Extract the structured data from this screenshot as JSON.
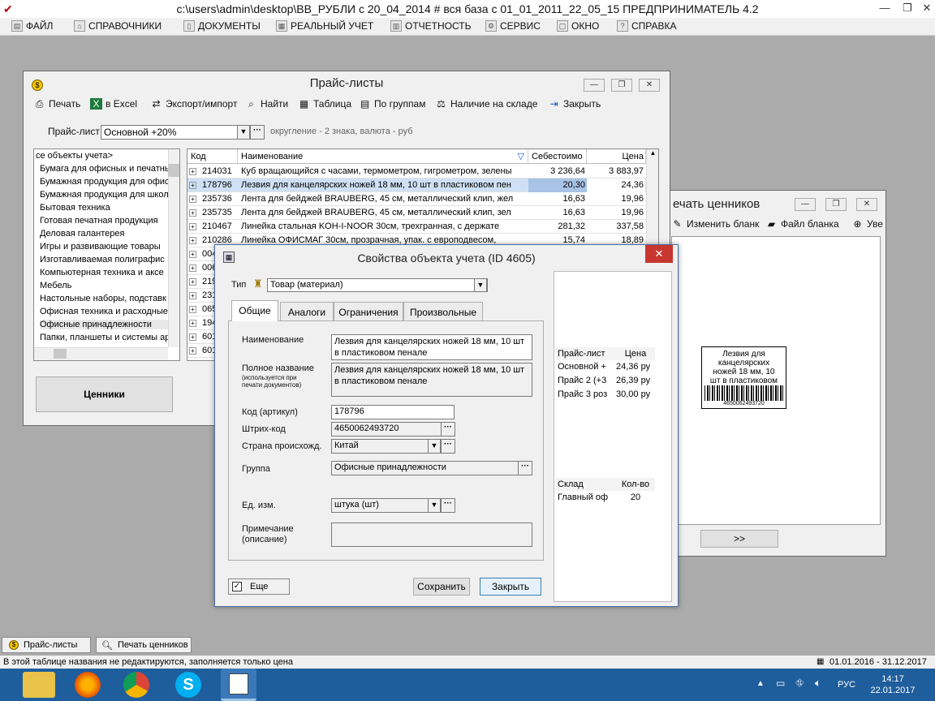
{
  "app": {
    "title": "c:\\users\\admin\\desktop\\BB_РУБЛИ с 20_04_2014 # вся база с 01_01_2011_22_05_15  ПРЕДПРИНИМАТЕЛЬ 4.2",
    "min": "—",
    "max": "❐",
    "close": "✕"
  },
  "menu": [
    "ФАЙЛ",
    "СПРАВОЧНИКИ",
    "ДОКУМЕНТЫ",
    "РЕАЛЬНЫЙ УЧЕТ",
    "ОТЧЕТНОСТЬ",
    "СЕРВИС",
    "ОКНО",
    "СПРАВКА"
  ],
  "pricelist_window": {
    "title": "Прайс-листы",
    "toolbar": {
      "print": "Печать",
      "excel": "в Excel",
      "export": "Экспорт/импорт",
      "find": "Найти",
      "table": "Таблица",
      "groups": "По группам",
      "stock": "Наличие на складе",
      "close": "Закрыть"
    },
    "pricelist_label": "Прайс-лист",
    "pricelist_value": "Основной +20%",
    "rounding_note": "округление - 2 знака, валюта - руб",
    "tree_items": [
      "се объекты учета>",
      "Бумага для офисных и печатнь",
      "Бумажная продукция для офис",
      "Бумажная продукция для школ",
      "Бытовая техника",
      "Готовая печатная продукция",
      "Деловая галантерея",
      "Игры и развивающие товары",
      "Изготавливаемая полиграфис",
      "Компьютерная техника и аксе",
      "Мебель",
      "Настольные наборы, подставк",
      "Офисная техника и расходные",
      "Офисные принадлежности",
      "Папки, планшеты и системы ар"
    ],
    "grid_headers": {
      "code": "Код",
      "name": "Наименование",
      "cost": "Себестоимо",
      "price": "Цена"
    },
    "rows": [
      {
        "code": "214031",
        "name": "Куб вращающийся с часами, термометром, гигрометром, зелены",
        "cost": "3 236,64",
        "price": "3 883,97"
      },
      {
        "code": "178796",
        "name": "Лезвия для канцелярских ножей 18 мм, 10 шт в пластиковом пен",
        "cost": "20,30",
        "price": "24,36"
      },
      {
        "code": "235736",
        "name": "Лента для бейджей BRAUBERG, 45 см, металлический клип, жел",
        "cost": "16,63",
        "price": "19,96"
      },
      {
        "code": "235735",
        "name": "Лента для бейджей BRAUBERG, 45 см, металлический клип, зел",
        "cost": "16,63",
        "price": "19,96"
      },
      {
        "code": "210467",
        "name": "Линейка стальная KOH-I-NOOR 30см, трехгранная, с держате",
        "cost": "281,32",
        "price": "337,58"
      },
      {
        "code": "210286",
        "name": "Линейка ОФИСМАГ 30см, прозрачная, упак. с европодвесом,",
        "cost": "15,74",
        "price": "18,89"
      },
      {
        "code": "004",
        "name": "",
        "cost": "",
        "price": ""
      },
      {
        "code": "006",
        "name": "",
        "cost": "",
        "price": ""
      },
      {
        "code": "219",
        "name": "",
        "cost": "",
        "price": ""
      },
      {
        "code": "231",
        "name": "",
        "cost": "",
        "price": ""
      },
      {
        "code": "065",
        "name": "",
        "cost": "",
        "price": ""
      },
      {
        "code": "194",
        "name": "",
        "cost": "",
        "price": ""
      },
      {
        "code": "601",
        "name": "",
        "cost": "",
        "price": ""
      },
      {
        "code": "601",
        "name": "",
        "cost": "",
        "price": ""
      }
    ],
    "price_tags_button": "Ценники"
  },
  "tags_window": {
    "title": "ечать ценников",
    "edit_form": "Изменить бланк",
    "form_file": "Файл бланка",
    "uve": "Уве",
    "next_button": ">>"
  },
  "dialog": {
    "title": "Свойства объекта учета  (ID 4605)",
    "close": "✕",
    "type_label": "Тип",
    "type_value": "Товар (материал)",
    "tabs": [
      "Общие",
      "Аналоги",
      "Ограничения",
      "Произвольные"
    ],
    "name_label": "Наименование",
    "name_value_1": "Лезвия для канцелярских ножей 18 мм, 10 шт",
    "name_value_2": "в пластиковом пенале",
    "full_name_label": "Полное название",
    "full_name_hint_1": "(используется при",
    "full_name_hint_2": "печати документов)",
    "full_name_value_1": "Лезвия для канцелярских ножей 18 мм, 10 шт",
    "full_name_value_2": "в пластиковом пенале",
    "code_label": "Код (артикул)",
    "code_value": "178796",
    "barcode_label": "Штрих-код",
    "barcode_value": "4650062493720",
    "country_label": "Страна происхожд.",
    "country_value": "Китай",
    "group_label": "Группа",
    "group_value": "Офисные принадлежности",
    "unit_label": "Ед. изм.",
    "unit_value": "штука (шт)",
    "note_label_1": "Примечание",
    "note_label_2": "(описание)",
    "more_label": "Еще",
    "save": "Сохранить",
    "close_btn": "Закрыть",
    "prices": {
      "header_list": "Прайс-лист",
      "header_price": "Цена",
      "rows": [
        {
          "name": "Основной +",
          "price": "24,36 ру"
        },
        {
          "name": "Прайс 2 (+3",
          "price": "26,39 ру"
        },
        {
          "name": "Прайс 3 роз",
          "price": "30,00 ру"
        }
      ]
    },
    "stock": {
      "header_store": "Склад",
      "header_qty": "Кол-во",
      "rows": [
        {
          "store": "Главный оф",
          "qty": "20"
        }
      ]
    }
  },
  "label_preview": {
    "line1": "Лезвия для",
    "line2": "канцелярских",
    "line3": "ножей 18 мм, 10",
    "line4": "шт в пластиковом",
    "barcode_text": "4650062493720"
  },
  "bottom_tabs": [
    "Прайс-листы",
    "Печать ценников"
  ],
  "status": {
    "hint": "В этой таблице названия не редактируются, заполняется только цена",
    "period": "01.01.2016 - 31.12.2017"
  },
  "taskbar": {
    "lang": "РУС",
    "time": "14:17",
    "date": "22.01.2017"
  }
}
